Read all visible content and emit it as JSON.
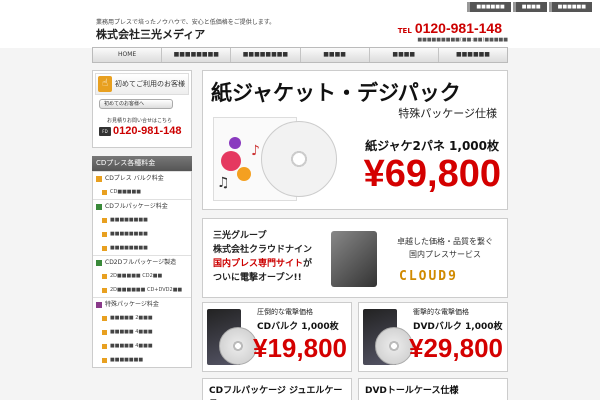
{
  "top_links": [
    "■■■■■■",
    "■■■■",
    "■■■■■■"
  ],
  "header": {
    "tagline": "業務用プレスで培ったノウハウで、安心と低価格をご提供します。",
    "company": "株式会社三光メディア",
    "tel_label": "TEL",
    "tel_number": "0120-981-148",
    "hours": "■■■■■■■■■(■■:■■)■■■■■"
  },
  "nav": [
    "HOME",
    "■■■■■■■■",
    "■■■■■■■■",
    "■■■■",
    "■■■■",
    "■■■■■■"
  ],
  "sidebar": {
    "first_title": "初めてご利用のお客様",
    "first_button": "初めてのお客様へ",
    "phone_label": "お見積りお問い合せはこちら",
    "phone_prefix": "FD",
    "phone_number": "0120-981-148",
    "price_header": "CDプレス各種料金",
    "sections": [
      {
        "label": "CDプレス バルク料金",
        "color": "#e8a020",
        "subs": [
          "CD■■■■■"
        ]
      },
      {
        "label": "CDフルパッケージ料金",
        "color": "#3a8a3a",
        "subs": [
          "■■■■■■■■",
          "■■■■■■■■",
          "■■■■■■■■"
        ]
      },
      {
        "label": "CD2Dフルパッケージ製造",
        "color": "#3a8a3a",
        "subs": [
          "2D■■■■■ CD2■■",
          "2D■■■■■■ CD+DVD2■■"
        ]
      },
      {
        "label": "特殊パッケージ料金",
        "color": "#8a3a8a",
        "subs": [
          "■■■■■ 2■■■",
          "■■■■■ 4■■■",
          "■■■■■ 4■■■",
          "■■■■■■■"
        ]
      }
    ]
  },
  "banner1": {
    "title": "紙ジャケット・デジパック",
    "subtitle": "特殊パッケージ仕様",
    "offer": "紙ジャケ2パネ 1,000枚",
    "price": "¥69,800"
  },
  "banner2": {
    "line1": "三光グループ",
    "line2": "株式会社クラウドナイン",
    "line3a": "国内プレス専門サイト",
    "line3b": "が",
    "line4": "ついに電撃オープン!!",
    "right1": "卓越した価格・品質を繋ぐ",
    "right2": "国内プレスサービス",
    "logo": "CLOUD9"
  },
  "banner_cd": {
    "l1": "圧倒的な電撃価格",
    "l2": "CDバルク 1,000枚",
    "price": "¥19,800"
  },
  "banner_dvd": {
    "l1": "衝撃的な電撃価格",
    "l2": "DVDバルク 1,000枚",
    "price": "¥29,800"
  },
  "banner_bottom_left": "CDフルパッケージ ジュエルケース",
  "banner_bottom_right": "DVDトールケース仕様"
}
